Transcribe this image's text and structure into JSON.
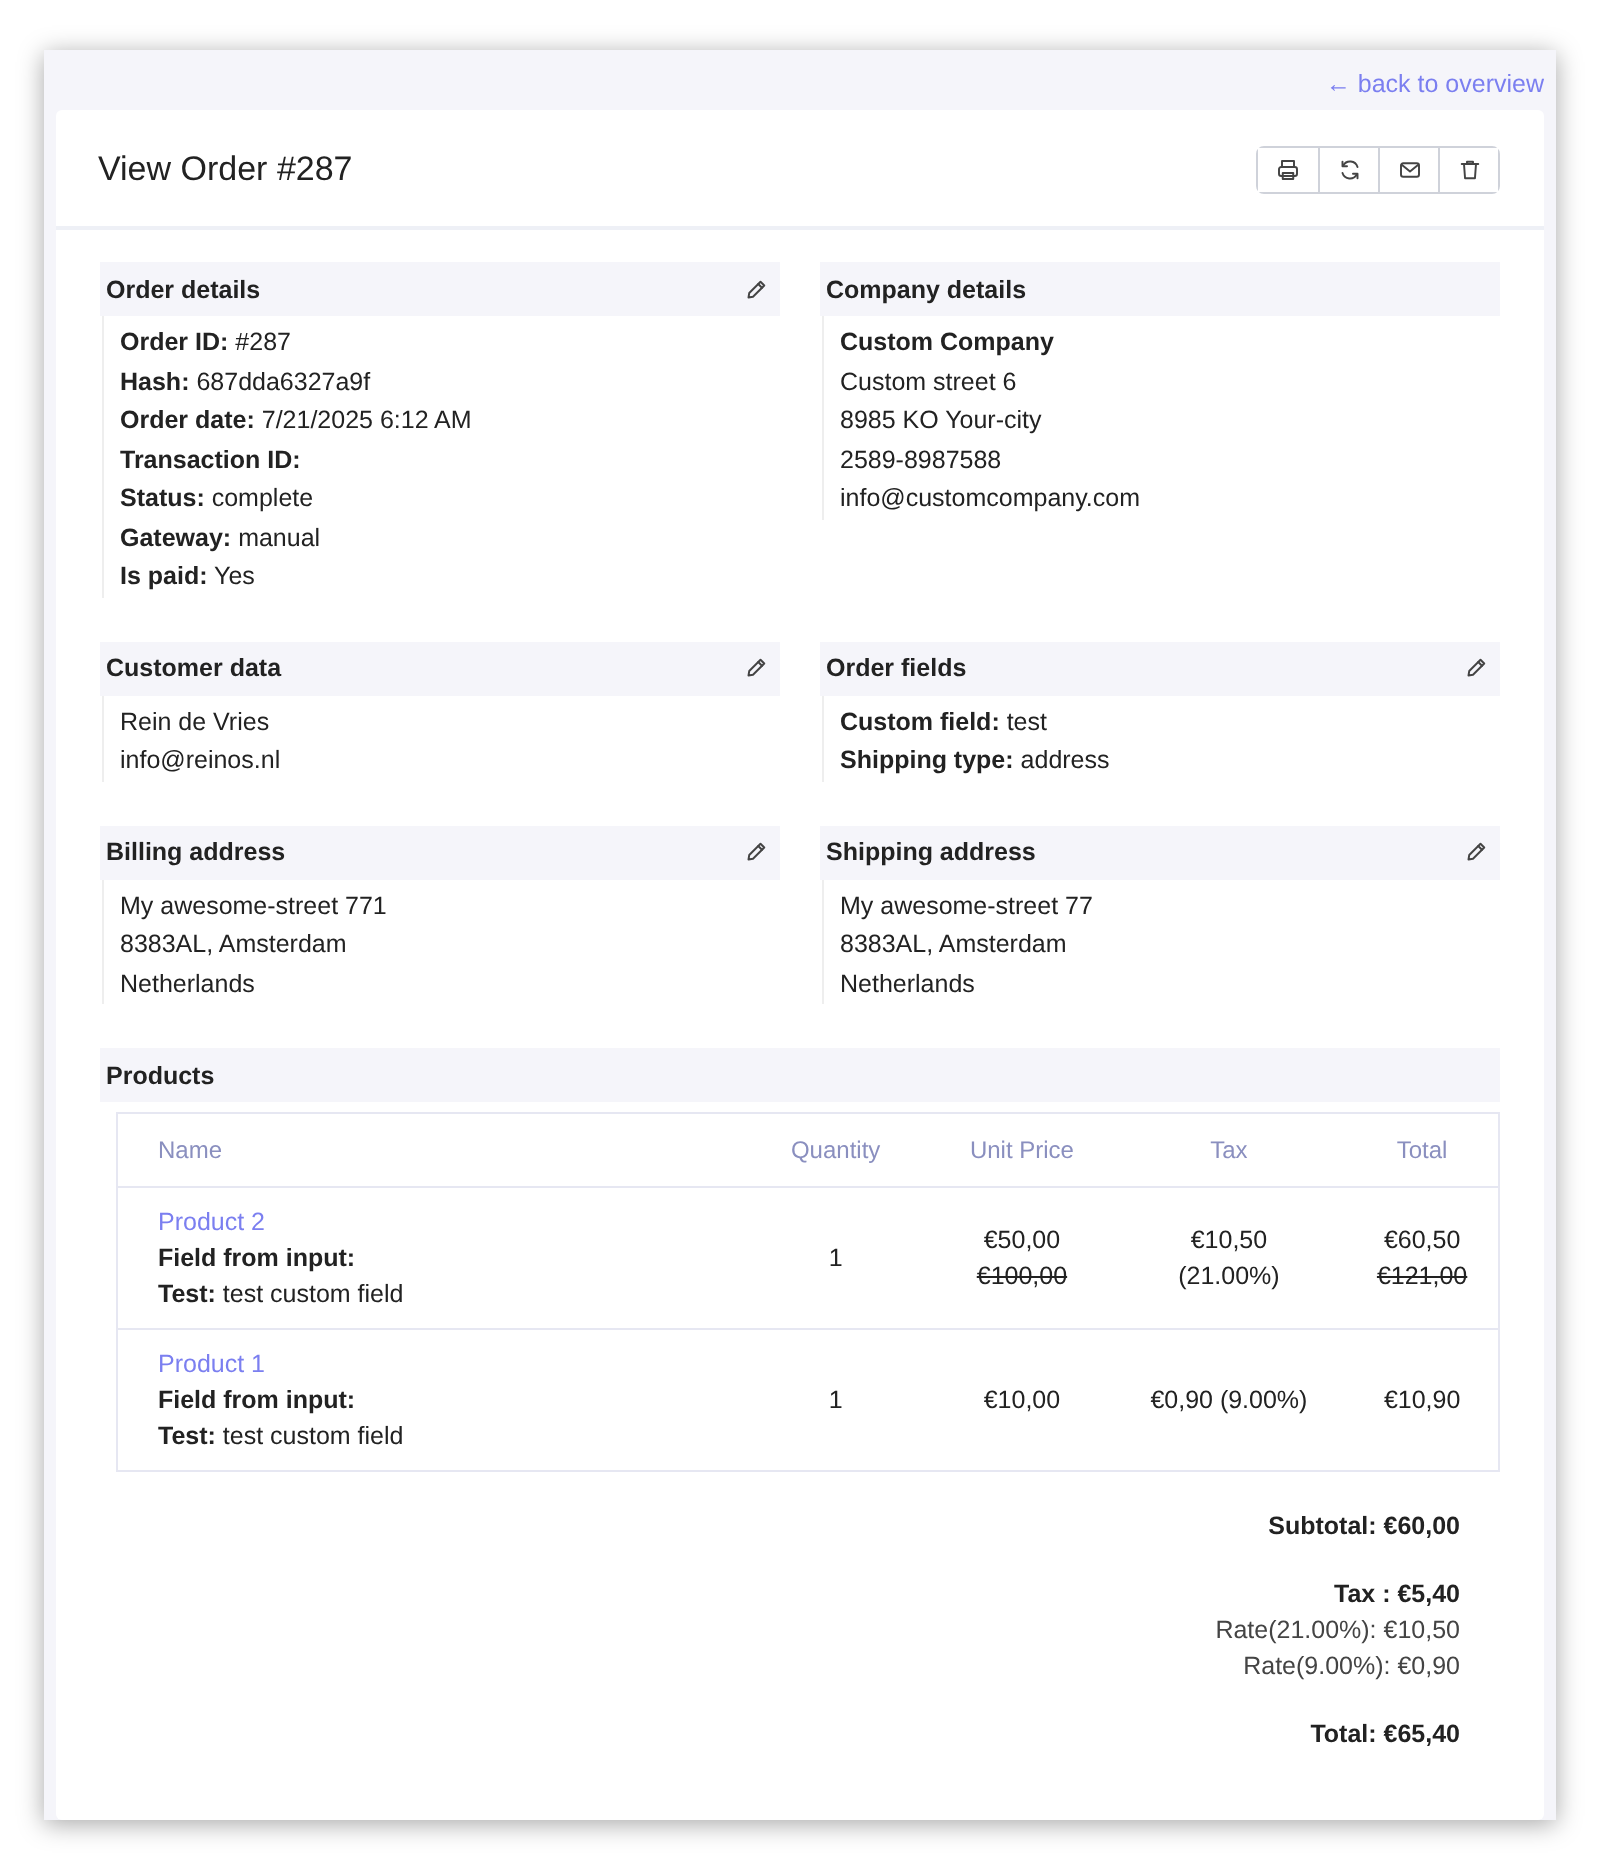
{
  "back_link": "← back to overview",
  "title": "View Order #287",
  "toolbar": [
    {
      "kind": "print"
    },
    {
      "kind": "refresh"
    },
    {
      "kind": "mail"
    },
    {
      "kind": "delete"
    }
  ],
  "sections": [
    {
      "title": "Order details",
      "editable": true,
      "lines": [
        {
          "text": "**Order ID:** #287",
          "kind": "plain"
        },
        {
          "text": "**Hash:** 687dda6327a9f",
          "kind": "plain"
        },
        {
          "text": "**Order date:** 7/21/2025 6:12 AM",
          "kind": "plain"
        },
        {
          "text": "Transaction ID:",
          "kind": "strong"
        },
        {
          "text": "**Status:** complete",
          "kind": "plain"
        },
        {
          "text": "**Gateway:** manual",
          "kind": "plain"
        },
        {
          "text": "**Is paid:** Yes",
          "kind": "plain"
        }
      ]
    },
    {
      "title": "Company details",
      "editable": false,
      "lines": [
        {
          "text": "Custom Company",
          "kind": "strong"
        },
        {
          "text": "Custom street 6",
          "kind": "plain"
        },
        {
          "text": "8985 KO Your-city",
          "kind": "plain"
        },
        {
          "text": "2589-8987588",
          "kind": "plain"
        },
        {
          "text": "info@customcompany.com",
          "kind": "plain"
        }
      ]
    },
    {
      "title": "Customer data",
      "editable": true,
      "lines": [
        {
          "text": "Rein de Vries",
          "kind": "plain"
        },
        {
          "text": "info@reinos.nl",
          "kind": "plain"
        }
      ]
    },
    {
      "title": "Order fields",
      "editable": true,
      "lines": [
        {
          "text": "**Custom field:** test",
          "kind": "plain"
        },
        {
          "text": "**Shipping type:** address",
          "kind": "plain"
        }
      ]
    },
    {
      "title": "Billing address",
      "editable": true,
      "lines": [
        {
          "text": "My awesome-street 771",
          "kind": "plain"
        },
        {
          "text": "8383AL, Amsterdam",
          "kind": "plain"
        },
        {
          "text": "Netherlands",
          "kind": "plain"
        }
      ]
    },
    {
      "title": "Shipping address",
      "editable": true,
      "lines": [
        {
          "text": "My awesome-street 77",
          "kind": "plain"
        },
        {
          "text": "8383AL, Amsterdam",
          "kind": "plain"
        },
        {
          "text": "Netherlands",
          "kind": "plain"
        }
      ]
    }
  ],
  "products": {
    "title": "Products",
    "columns": [
      "Name",
      "Quantity",
      "Unit Price",
      "Tax",
      "Total"
    ],
    "rows": [
      {
        "name": "Product 2",
        "fields": [
          "**Field from input:**",
          "**Test:** test custom field"
        ],
        "quantity": "1",
        "unit_price": "€50,00",
        "unit_price_original": "€100,00",
        "tax": [
          "€10,50",
          "(21.00%)"
        ],
        "total": "€60,50",
        "total_original": "€121,00"
      },
      {
        "name": "Product 1",
        "fields": [
          "**Field from input:**",
          "**Test:** test custom field"
        ],
        "quantity": "1",
        "unit_price": "€10,00",
        "tax": [
          "€0,90 (9.00%)"
        ],
        "total": "€10,90"
      }
    ]
  },
  "totals": [
    {
      "lines": [
        {
          "text": "Subtotal: €60,00",
          "kind": "strong"
        }
      ]
    },
    {
      "lines": [
        {
          "text": "Tax : €5,40",
          "kind": "strong"
        },
        {
          "text": "Rate(21.00%): €10,50",
          "kind": "plain"
        },
        {
          "text": "Rate(9.00%): €0,90",
          "kind": "plain"
        }
      ]
    },
    {
      "lines": [
        {
          "text": "Total: €65,40",
          "kind": "strong"
        }
      ]
    }
  ]
}
